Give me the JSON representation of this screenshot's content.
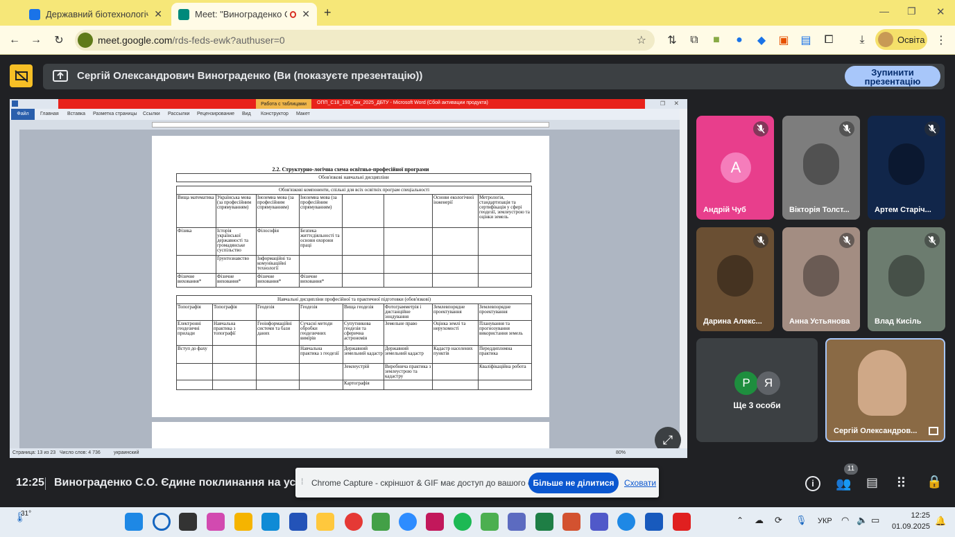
{
  "browser": {
    "tabs": [
      {
        "title": "Державний біотехнологічний",
        "active": false
      },
      {
        "title": "Meet: \"Винограденко С.О.",
        "active": true
      }
    ],
    "url_host": "meet.google.com",
    "url_path": "/rds-feds-ewk?authuser=0",
    "profile_label": "Освіта"
  },
  "meet": {
    "presenting_text": "Сергій Олександрович Винограденко (Ви (показуєте презентацію))",
    "stop_button_line1": "Зупинити",
    "stop_button_line2": "презентацію",
    "participants": [
      {
        "name": "Андрій Чуб",
        "initial": "А",
        "color": "#e83e8c"
      },
      {
        "name": "Вікторія Толст...",
        "initial": "",
        "color": "#7d7d7d"
      },
      {
        "name": "Артем Старіч...",
        "initial": "",
        "color": "#11264a"
      },
      {
        "name": "Дарина Алекс...",
        "initial": "",
        "color": "#6a4f33"
      },
      {
        "name": "Анна Устьянова",
        "initial": "",
        "color": "#a38d82"
      },
      {
        "name": "Влад Кисіль",
        "initial": "",
        "color": "#6c7c6f"
      }
    ],
    "others": {
      "label": "Ще 3 особи",
      "initials": [
        "Р",
        "Я"
      ]
    },
    "self_name": "Сергій Олександров...",
    "clock": "12:25",
    "meeting_name": "Винограденко С.О. Єдине поклинання на усі за...",
    "participant_count": "11",
    "capture_message": "Chrome Capture - скріншот & GIF має доступ до вашого екрана.",
    "capture_stop": "Більше не ділитися",
    "capture_hide": "Сховати"
  },
  "word": {
    "context_tab": "Работа с таблицами",
    "doc_title": "ОПП_С18_193_бак_2025_ДБТУ - Microsoft Word (Сбой активации продукта)",
    "menu": [
      "Файл",
      "Главная",
      "Вставка",
      "Разметка страницы",
      "Ссылки",
      "Рассылки",
      "Рецензирование",
      "Вид",
      "Конструктор",
      "Макет"
    ],
    "status": {
      "page": "Страница: 13 из 23",
      "words": "Число слов: 4 736",
      "lang": "украинский",
      "zoom": "80%"
    },
    "heading": "2.2.     Структурно-логічна схема освітньо-професійної програми",
    "t1_title": "Обов'язкові навчальні дисципліни",
    "t2_title": "Обов'язкові компоненти, спільні для всіх освітніх програм спеціальності",
    "t2_rows": [
      [
        "Вища математика",
        "Українська мова (за професійним спрямуванням)",
        "Іноземна мова (за професійним спрямуванням)",
        "Іноземна мова (за професійним спрямуванням)",
        "",
        "",
        "Основи екологічної інженерії",
        "Метрологія, стандартизація та сертифікація у сфері геодезії, землеустрою та оцінки земель"
      ],
      [
        "Фізика",
        "Історія української державності та громадянське суспільство",
        "Філософія",
        "Безпека життєдіяльності та основи охорони праці",
        "",
        "",
        "",
        ""
      ],
      [
        "",
        "Ґрунтознавство",
        "Інформаційні та комунікаційні технології",
        "",
        "",
        "",
        "",
        ""
      ],
      [
        "Фізичне виховання*",
        "Фізичне виховання*",
        "Фізичне виховання*",
        "Фізичне виховання*",
        "",
        "",
        "",
        ""
      ]
    ],
    "t3_title": "Навчальні дисципліни професійної та практичної підготовки (обов'язкові)",
    "t3_rows": [
      [
        "Топографія",
        "Топографія",
        "Геодезія",
        "Геодезія",
        "Вища геодезія",
        "Фотограмметрія і дистанційне зондування",
        "Землевпорядне проектування",
        "Землевпорядне проектування"
      ],
      [
        "Електронні геодезичні прилади",
        "Навчальна практика з топографії",
        "Геоінформаційні системи та бази даних",
        "Сучасні методи обробки геодезичних вимірів",
        "Супутникова геодезія та сферична астрономія",
        "Земельне право",
        "Оцінка землі та нерухомості",
        "Планування та прогнозування використання земель"
      ],
      [
        "Вступ до фаху",
        "",
        "",
        "Навчальна практика з геодезії",
        "Державний земельний кадастр",
        "Державний земельний кадастр",
        "Кадастр населених пунктів",
        "Переддипломна практика"
      ],
      [
        "",
        "",
        "",
        "",
        "Землеустрій",
        "Виробнича практика з землеустрою та кадастру",
        "",
        "Кваліфікаційна робота"
      ],
      [
        "",
        "",
        "",
        "",
        "Картографія",
        "",
        "",
        ""
      ]
    ]
  },
  "taskbar": {
    "weather": "31°",
    "lang": "УКР",
    "time": "12:25",
    "date": "01.09.2025"
  }
}
